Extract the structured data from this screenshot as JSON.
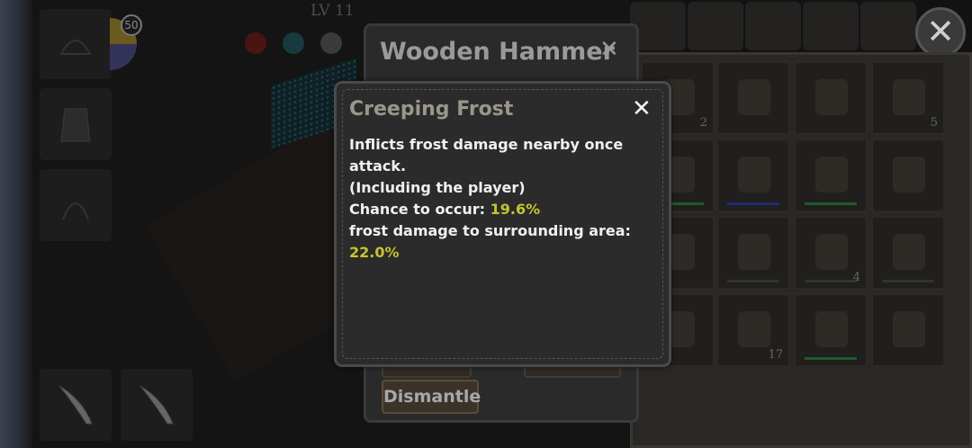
{
  "hud": {
    "level": "LV 11",
    "badge_count": "50"
  },
  "item_window": {
    "title": "Wooden Hammer",
    "close_symbol": "✕",
    "dismantle_label": "Dismantle"
  },
  "tooltip": {
    "title": "Creeping Frost",
    "close_symbol": "✕",
    "line1": "Inflicts frost damage nearby once attack.",
    "line2": "(Including the player)",
    "chance_label": "Chance to occur: ",
    "chance_value": "19.6%",
    "area_label": "frost damage to surrounding area: ",
    "area_value": "22.0%"
  },
  "inventory": {
    "close_symbol": "✕",
    "items": [
      {
        "name": "potion-bottle",
        "count": "2"
      },
      {
        "name": "scroll",
        "count": ""
      },
      {
        "name": "axe",
        "count": ""
      },
      {
        "name": "gear",
        "count": "5"
      },
      {
        "name": "meat",
        "count": ""
      },
      {
        "name": "water-flask",
        "count": ""
      },
      {
        "name": "wood-planks",
        "count": ""
      },
      {
        "name": "fishing-rod",
        "count": ""
      },
      {
        "name": "unknown",
        "count": ""
      },
      {
        "name": "bone-wand",
        "count": ""
      },
      {
        "name": "hay-bundle",
        "count": "4"
      },
      {
        "name": "shovel",
        "count": ""
      },
      {
        "name": "hammer",
        "count": ""
      },
      {
        "name": "grass-bundle",
        "count": "17"
      },
      {
        "name": "banana",
        "count": ""
      },
      {
        "name": "key",
        "count": ""
      }
    ]
  },
  "colors": {
    "highlight": "#c8c330",
    "tooltip_bg": "#2b2b2b"
  }
}
